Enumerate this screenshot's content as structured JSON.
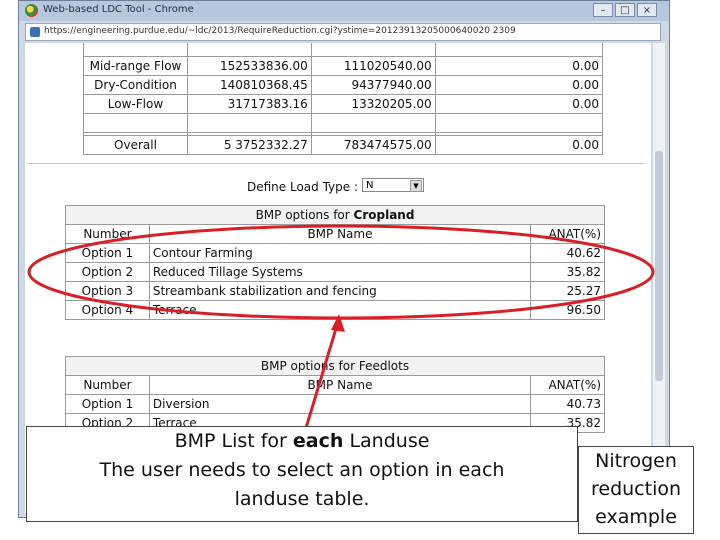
{
  "window": {
    "title": "Web-based LDC Tool - Chrome",
    "url": "https://engineering.purdue.edu/~ldc/2013/RequireReduction.cgi?ystime=20123913205000640020 2309"
  },
  "flow_table": {
    "rows": [
      {
        "label": "Mid-range Flow",
        "v1": "152533836.00",
        "v2": "111020540.00",
        "v3": "0.00"
      },
      {
        "label": "Dry-Condition",
        "v1": "140810368.45",
        "v2": "94377940.00",
        "v3": "0.00"
      },
      {
        "label": "Low-Flow",
        "v1": "31717383.16",
        "v2": "13320205.00",
        "v3": "0.00"
      }
    ],
    "overall": {
      "label": "Overall",
      "v1": "5 3752332.27",
      "v2": "783474575.00",
      "v3": "0.00"
    }
  },
  "load_type": {
    "label": "Define Load Type :",
    "value": "N"
  },
  "cropland": {
    "title_prefix": "BMP options for ",
    "title_bold": "Cropland",
    "headers": [
      "Number",
      "BMP Name",
      "ANAT(%)"
    ],
    "rows": [
      {
        "number": "Option 1",
        "name": "Contour Farming",
        "value": "40.62"
      },
      {
        "number": "Option 2",
        "name": "Reduced Tillage Systems",
        "value": "35.82"
      },
      {
        "number": "Option 3",
        "name": "Streambank stabilization and fencing",
        "value": "25.27"
      },
      {
        "number": "Option 4",
        "name": "Terrace",
        "value": "96.50"
      }
    ]
  },
  "feedlots": {
    "title": "BMP options for Feedlots",
    "headers": [
      "Number",
      "BMP Name",
      "ANAT(%)"
    ],
    "rows": [
      {
        "number": "Option 1",
        "name": "Diversion",
        "value": "40.73"
      },
      {
        "number": "Option 2",
        "name": "Terrace",
        "value": "35.82"
      }
    ]
  },
  "callout": {
    "line1_prefix": "BMP List for ",
    "line1_bold": "each",
    "line1_suffix": " Landuse",
    "line2": "The user needs to select an option in each",
    "line3": "landuse table."
  },
  "note": {
    "line1": "Nitrogen",
    "line2": "reduction",
    "line3": "example"
  },
  "colors": {
    "highlight": "#d81f26",
    "window_frame": "#cfd8e6",
    "titlebar": "#b9c7dc"
  }
}
